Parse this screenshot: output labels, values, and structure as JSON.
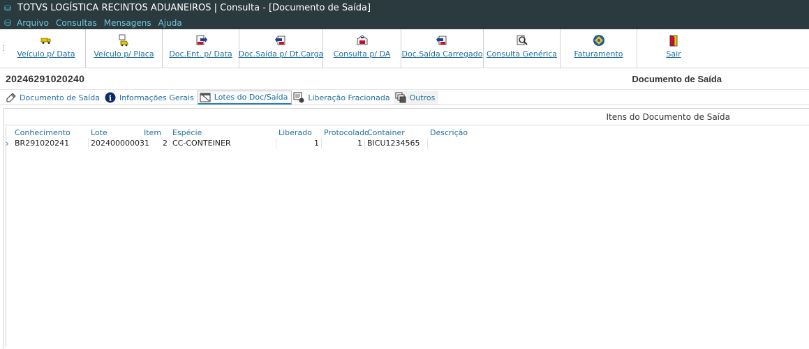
{
  "window": {
    "title": "TOTVS LOGÍSTICA RECINTOS ADUANEIROS | Consulta - [Documento de Saída]"
  },
  "menu": [
    "Arquivo",
    "Consultas",
    "Mensagens",
    "Ajuda"
  ],
  "toolbar": [
    {
      "label": "Veículo p/ Data",
      "icon": "truck-yellow-icon"
    },
    {
      "label": "Veículo p/ Placa",
      "icon": "vehicle-plate-icon"
    },
    {
      "label": "Doc.Ent. p/ Data",
      "icon": "doc-in-date-icon"
    },
    {
      "label": "Doc.Saída p/ Dt.Carga",
      "icon": "doc-out-load-date-icon"
    },
    {
      "label": "Consulta p/ DA",
      "icon": "query-da-icon"
    },
    {
      "label": "Doc.Saída Carregado",
      "icon": "doc-out-loaded-icon"
    },
    {
      "label": "Consulta Genérica",
      "icon": "generic-query-icon"
    },
    {
      "label": "Faturamento",
      "icon": "billing-icon"
    },
    {
      "label": "Sair",
      "icon": "exit-door-icon"
    }
  ],
  "document": {
    "number": "20246291020240",
    "section_title": "Documento de Saída"
  },
  "tabs": [
    {
      "label": "Documento de Saída",
      "icon": "edit-doc-icon",
      "active": false
    },
    {
      "label": "Informações Gerais",
      "icon": "info-icon",
      "active": false
    },
    {
      "label": "Lotes do Doc/Saída",
      "icon": "lots-doc-icon",
      "active": true
    },
    {
      "label": "Liberação Fracionada",
      "icon": "partial-release-icon",
      "active": false
    },
    {
      "label": "Outros",
      "icon": "others-icon",
      "active": false
    }
  ],
  "panel": {
    "title": "Itens do Documento de Saída"
  },
  "grid": {
    "columns": [
      "Conhecimento",
      "Lote",
      "Item",
      "Espécie",
      "Liberado",
      "Protocolado",
      "Container",
      "Descrição"
    ],
    "rows": [
      [
        "BR291020241",
        "202400000031",
        "2",
        "CC-CONTEINER",
        "1",
        "1",
        "BICU1234565",
        ""
      ]
    ]
  },
  "colors": {
    "titlebar_bg": "#2b3a3f",
    "accent": "#1f6f9e",
    "menu_text": "#6fc7dc"
  }
}
